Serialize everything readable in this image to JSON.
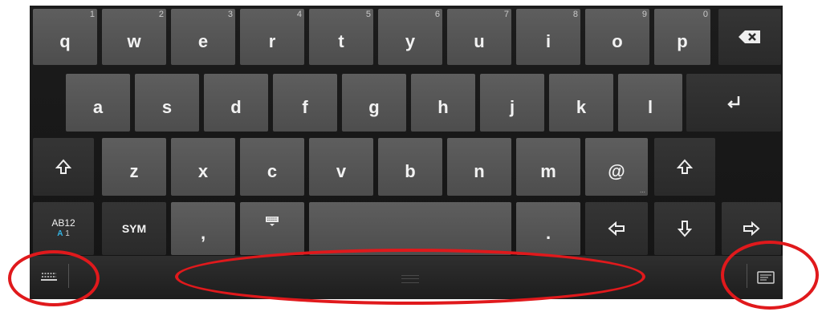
{
  "keyboard": {
    "row1": [
      {
        "label": "q",
        "num": "1"
      },
      {
        "label": "w",
        "num": "2"
      },
      {
        "label": "e",
        "num": "3"
      },
      {
        "label": "r",
        "num": "4"
      },
      {
        "label": "t",
        "num": "5"
      },
      {
        "label": "y",
        "num": "6"
      },
      {
        "label": "u",
        "num": "7"
      },
      {
        "label": "i",
        "num": "8"
      },
      {
        "label": "o",
        "num": "9"
      },
      {
        "label": "p",
        "num": "0"
      }
    ],
    "row2": [
      "a",
      "s",
      "d",
      "f",
      "g",
      "h",
      "j",
      "k",
      "l"
    ],
    "row3": [
      "z",
      "x",
      "c",
      "v",
      "b",
      "n",
      "m",
      "@"
    ],
    "mode_key": {
      "top": "AB12",
      "accent": "A",
      "num": "1"
    },
    "sym_label": "SYM",
    "comma": ",",
    "period": "."
  },
  "icons": {
    "backspace": "backspace-icon",
    "enter": "enter-icon",
    "shift": "shift-icon",
    "keyboard_settings": "keyboard-settings-icon",
    "arrows": [
      "arrow-left-icon",
      "arrow-down-icon",
      "arrow-right-icon"
    ],
    "hide_keyboard": "hide-keyboard-icon",
    "switch_input": "switch-input-method-icon"
  },
  "colors": {
    "key_light": "#555555",
    "key_dark": "#303030",
    "background": "#161616",
    "accent": "#33b5e5",
    "annotation": "#e0191c"
  }
}
